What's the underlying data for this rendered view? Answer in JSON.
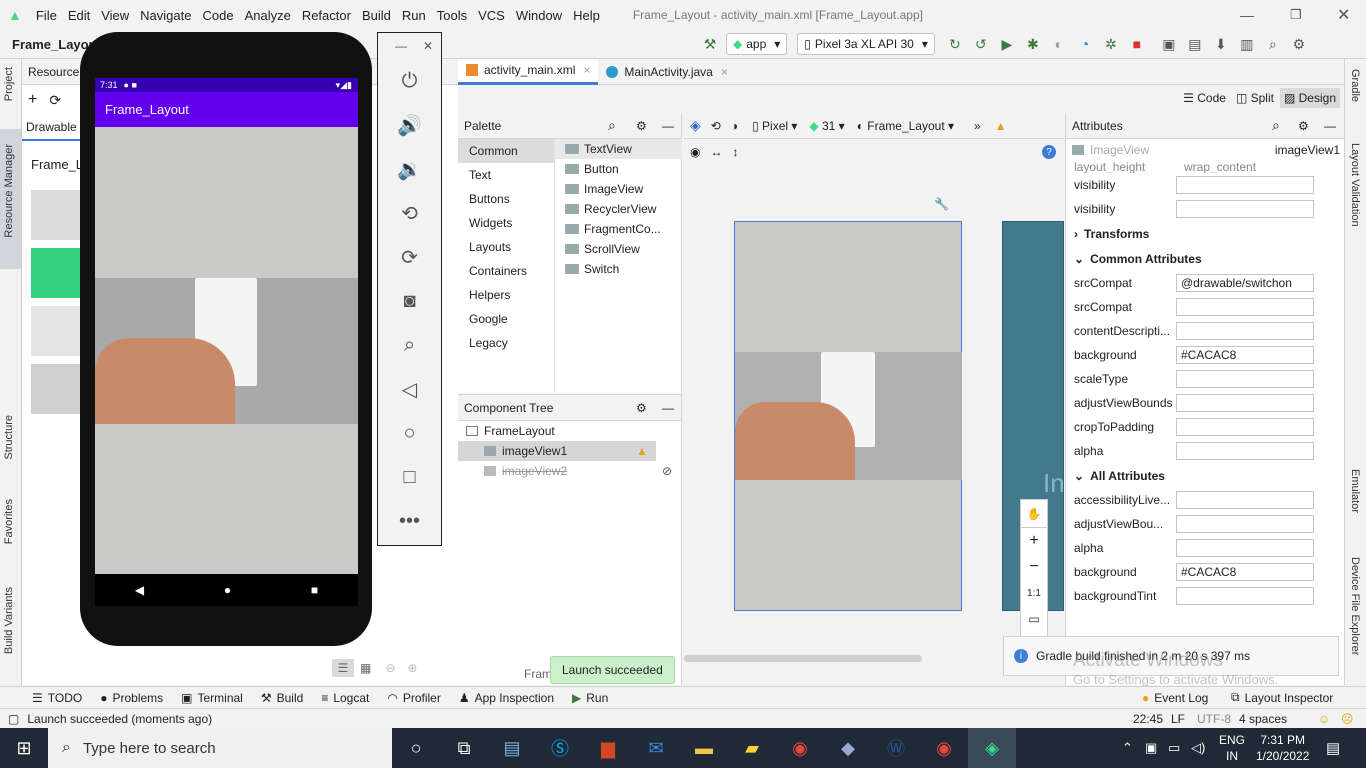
{
  "menu": {
    "items": [
      "File",
      "Edit",
      "View",
      "Navigate",
      "Code",
      "Analyze",
      "Refactor",
      "Build",
      "Run",
      "Tools",
      "VCS",
      "Window",
      "Help"
    ],
    "window_title": "Frame_Layout - activity_main.xml [Frame_Layout.app]"
  },
  "toolbar": {
    "project_crumb": "Frame_Layout",
    "run_config": "app",
    "device": "Pixel 3a XL API 30"
  },
  "left_tools": {
    "project": "Project",
    "resource_manager": "Resource Manager",
    "structure": "Structure",
    "favorites": "Favorites",
    "build_variants": "Build Variants"
  },
  "right_tools": {
    "gradle": "Gradle",
    "layout_validation": "Layout Validation",
    "emulator": "Emulator",
    "device_file_explorer": "Device File Explorer"
  },
  "resource_manager": {
    "title": "Resource M",
    "tab": "Drawable",
    "module": "Frame_L"
  },
  "phone": {
    "time": "7:31",
    "app_title": "Frame_Layout",
    "accent": "#6200EE"
  },
  "editor": {
    "tabs": [
      "activity_main.xml",
      "MainActivity.java"
    ],
    "view_modes": {
      "code": "Code",
      "split": "Split",
      "design": "Design"
    }
  },
  "palette": {
    "title": "Palette",
    "categories": [
      "Common",
      "Text",
      "Buttons",
      "Widgets",
      "Layouts",
      "Containers",
      "Helpers",
      "Google",
      "Legacy"
    ],
    "items": [
      "TextView",
      "Button",
      "ImageView",
      "RecyclerView",
      "FragmentCo...",
      "ScrollView",
      "Switch"
    ]
  },
  "design_toolbar": {
    "device": "Pixel",
    "api": "31",
    "theme": "Frame_Layout"
  },
  "component_tree": {
    "title": "Component Tree",
    "root": "FrameLayout",
    "children": [
      "imageView1",
      "imageView2"
    ]
  },
  "attributes": {
    "title": "Attributes",
    "widget_type": "ImageView",
    "widget_id": "imageView1",
    "partial_row": "layout_height",
    "partial_value": "wrap_content",
    "rows_top": [
      {
        "name": "visibility",
        "value": ""
      },
      {
        "name": "visibility",
        "value": ""
      }
    ],
    "transforms": "Transforms",
    "common_title": "Common Attributes",
    "common": [
      {
        "name": "srcCompat",
        "value": "@drawable/switchon"
      },
      {
        "name": "srcCompat",
        "value": ""
      },
      {
        "name": "contentDescripti...",
        "value": ""
      },
      {
        "name": "background",
        "value": "#CACAC8"
      },
      {
        "name": "scaleType",
        "value": ""
      },
      {
        "name": "adjustViewBounds",
        "value": ""
      },
      {
        "name": "cropToPadding",
        "value": ""
      },
      {
        "name": "alpha",
        "value": ""
      }
    ],
    "all_title": "All Attributes",
    "all": [
      {
        "name": "accessibilityLive...",
        "value": ""
      },
      {
        "name": "adjustViewBou...",
        "value": ""
      },
      {
        "name": "alpha",
        "value": ""
      },
      {
        "name": "background",
        "value": "#CACAC8"
      },
      {
        "name": "backgroundTint",
        "value": ""
      }
    ]
  },
  "toast": "Launch succeeded",
  "gradle_notice": "Gradle build finished in 2 m 20 s 397 ms",
  "watermark": {
    "line1": "Activate Windows",
    "line2": "Go to Settings to activate Windows."
  },
  "partial_label": "Fram",
  "canvas_text": "In",
  "zoom_fit": "1:1",
  "bottom_tools": [
    "TODO",
    "Problems",
    "Terminal",
    "Build",
    "Logcat",
    "Profiler",
    "App Inspection",
    "Run"
  ],
  "bottom_right": [
    "Event Log",
    "Layout Inspector"
  ],
  "status": {
    "message": "Launch succeeded (moments ago)",
    "position": "22:45",
    "line_sep": "LF",
    "encoding": "UTF-8",
    "indent": "4 spaces"
  },
  "taskbar": {
    "search_placeholder": "Type here to search",
    "lang1": "ENG",
    "lang2": "IN",
    "time": "7:31 PM",
    "date": "1/20/2022"
  },
  "background_color": "#CACAC8"
}
